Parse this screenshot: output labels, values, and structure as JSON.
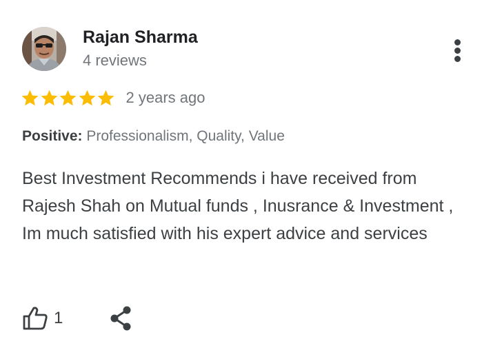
{
  "review": {
    "author_name": "Rajan Sharma",
    "review_count": "4 reviews",
    "rating": 5,
    "rating_max": 5,
    "date": "2 years ago",
    "highlights_label": "Positive:",
    "highlights_value": " Professionalism, Quality, Value",
    "text": "Best Investment Recommends i have received from Rajesh Shah on Mutual funds , Inusrance & Investment , Im much satisfied with his expert advice and services",
    "like_count": "1"
  },
  "icons": {
    "avatar": "profile-photo",
    "more": "more-vert-icon",
    "star": "star-icon",
    "like": "thumb-up-outline-icon",
    "share": "share-icon"
  },
  "colors": {
    "star": "#fbbc04",
    "primary_text": "#202124",
    "body_text": "#3c4043",
    "secondary_text": "#70757a"
  }
}
